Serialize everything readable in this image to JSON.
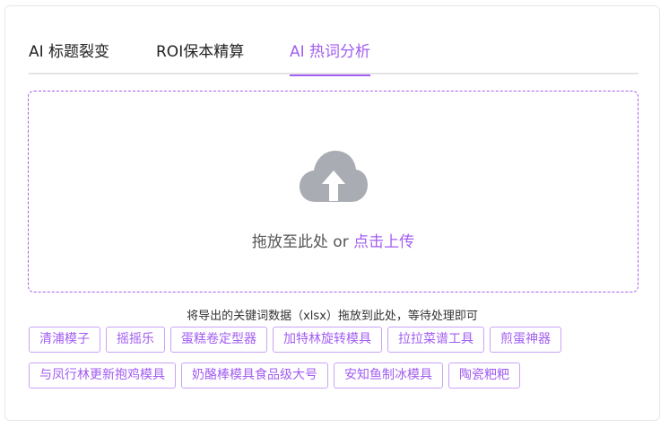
{
  "tabs": [
    {
      "label": "AI 标题裂变"
    },
    {
      "label": "ROI保本精算"
    },
    {
      "label": "AI 热词分析"
    }
  ],
  "active_tab": "AI 热词分析",
  "upload": {
    "icon": "cloud-upload-icon",
    "text_main": "拖放至此处",
    "text_or": " or ",
    "text_link": "点击上传",
    "hint": "将导出的关键词数据（xlsx）拖放到此处，等待处理即可"
  },
  "tags_row1": [
    "清浦模子",
    "摇摇乐",
    "蛋糕卷定型器",
    "加特林旋转模具",
    "拉拉菜谱工具",
    "煎蛋神器"
  ],
  "tags_row2": [
    "与凤行林更新抱鸡模具",
    "奶酪棒模具食品级大号",
    "安知鱼制冰模具",
    "陶瓷粑粑"
  ],
  "colors": {
    "accent": "#a25ef0",
    "icon_gray": "#a9acb3"
  }
}
